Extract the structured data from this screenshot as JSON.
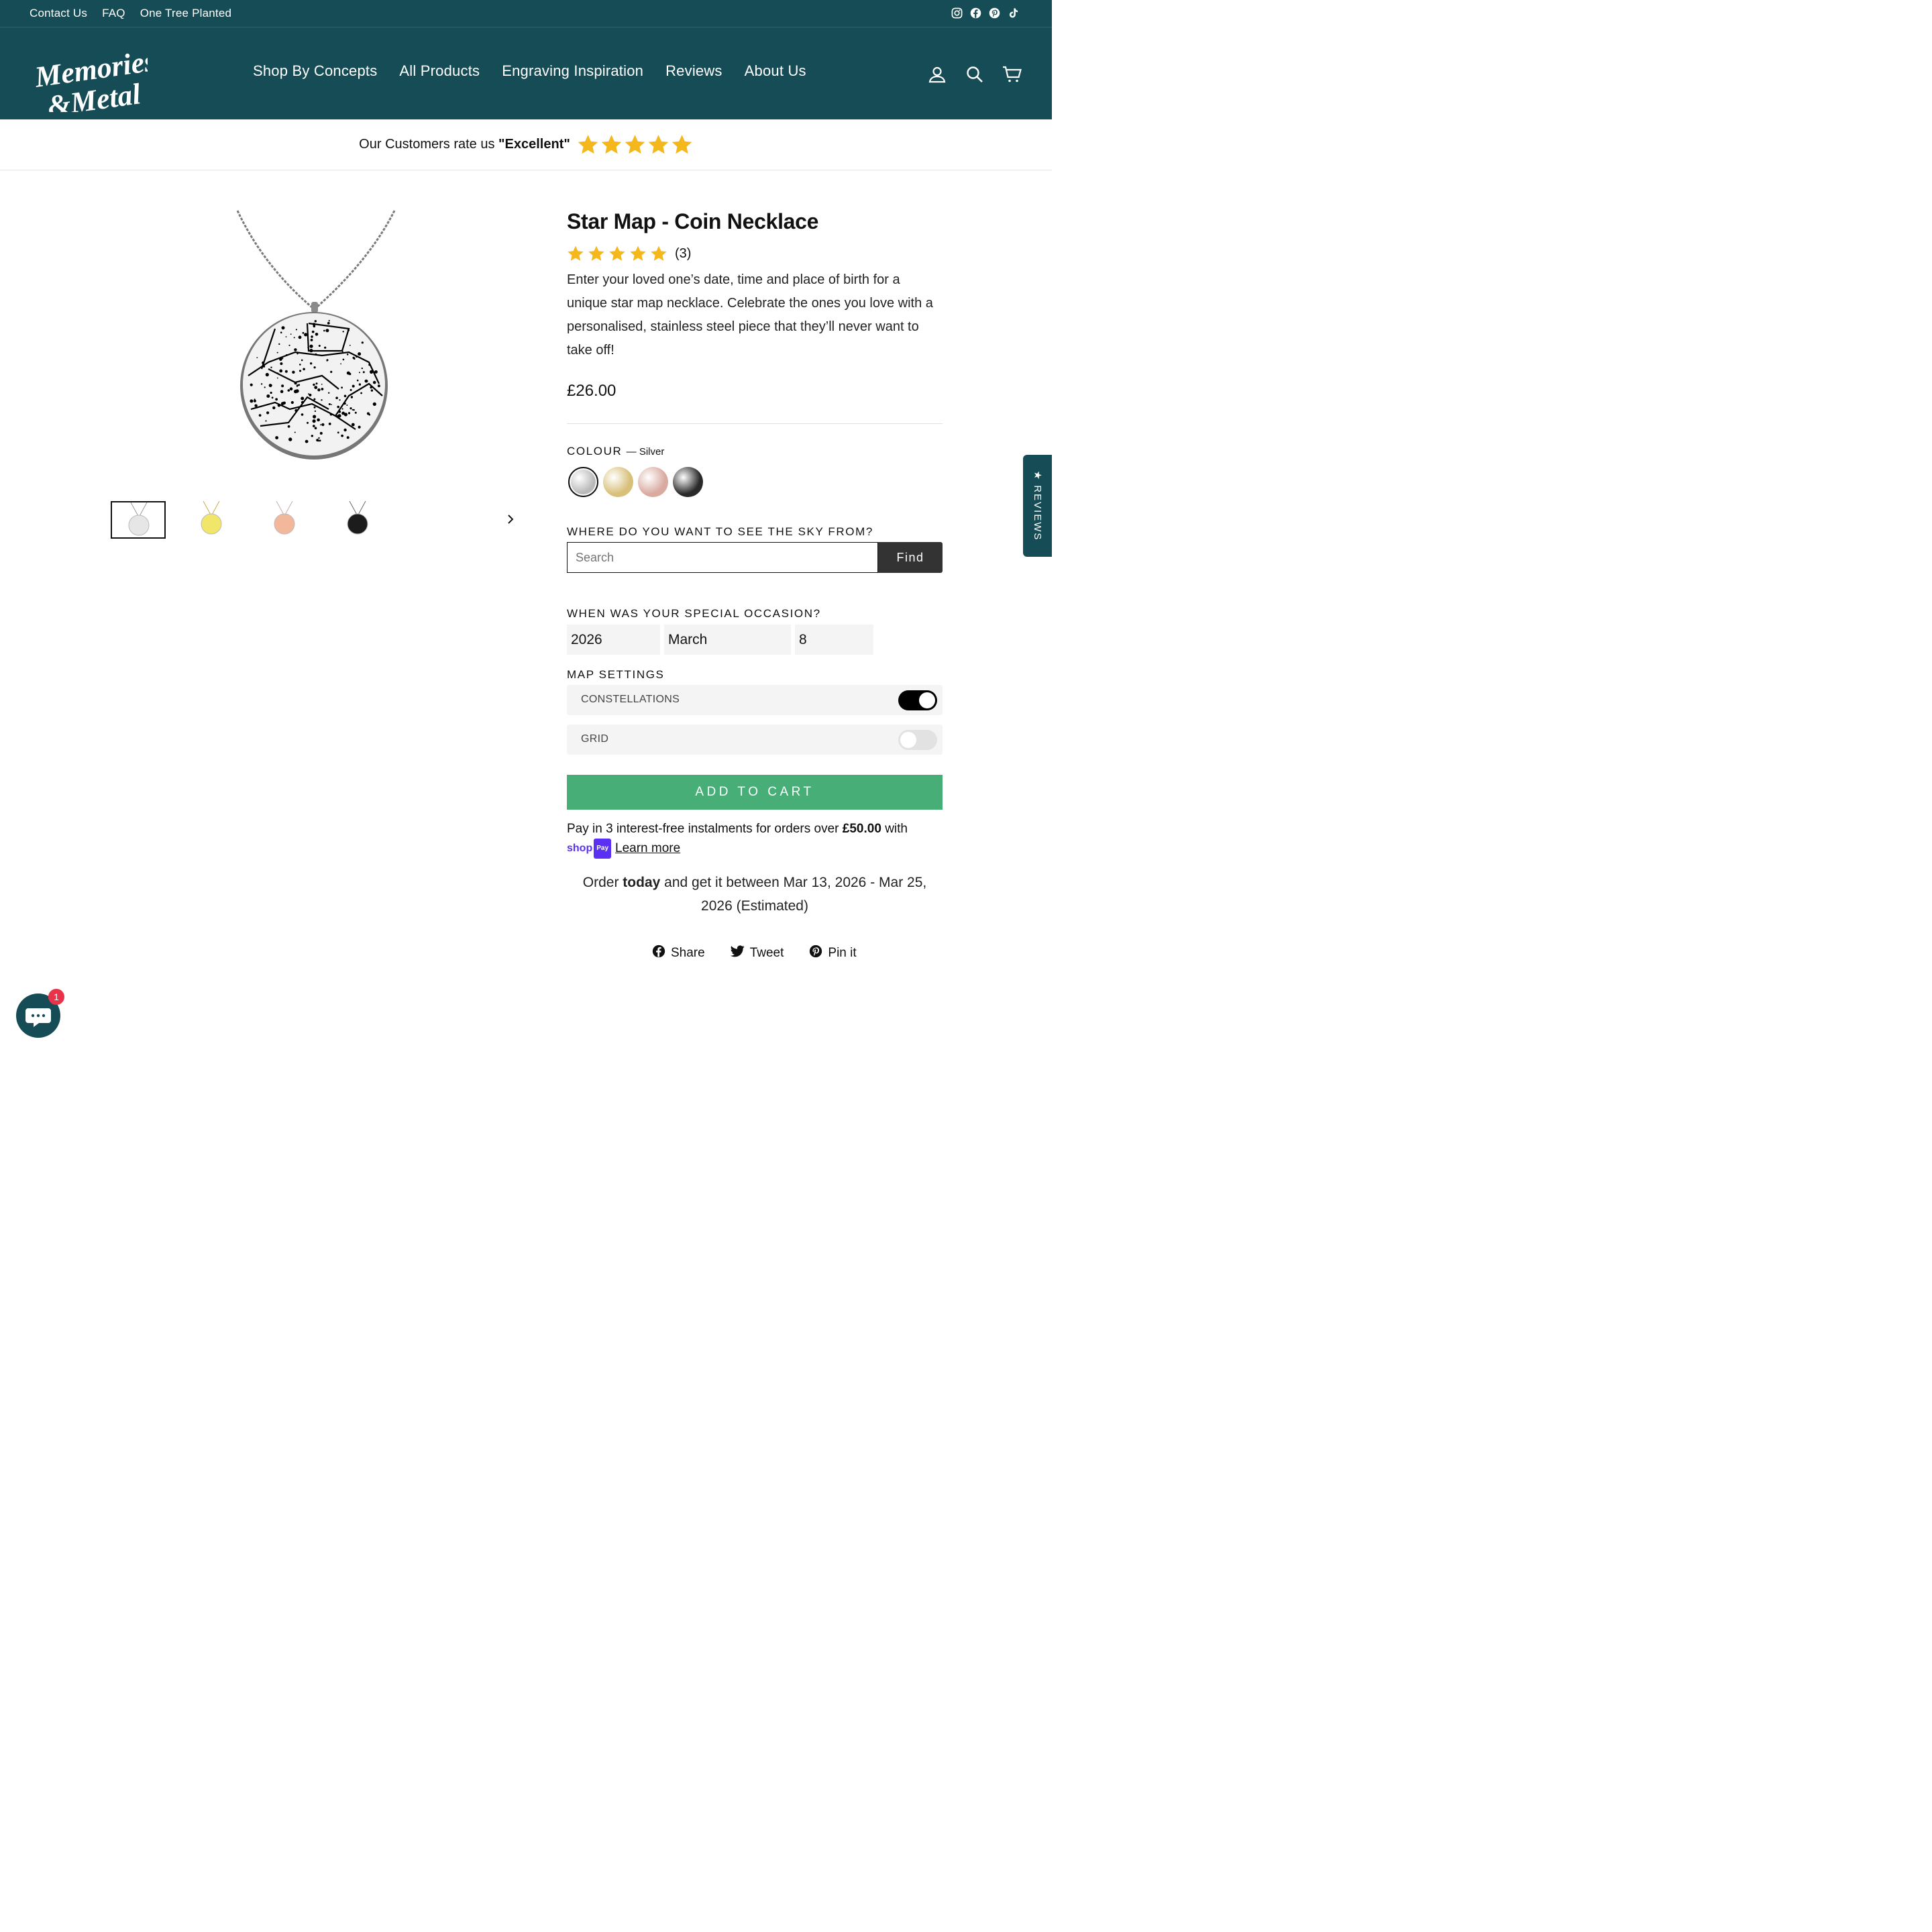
{
  "topbar": {
    "links": [
      "Contact Us",
      "FAQ",
      "One Tree Planted"
    ],
    "social_icons": [
      "instagram-icon",
      "facebook-icon",
      "pinterest-icon",
      "tiktok-icon"
    ]
  },
  "header": {
    "logo_text": "Memories & Metal",
    "nav": [
      "Shop By Concepts",
      "All Products",
      "Engraving Inspiration",
      "Reviews",
      "About Us"
    ],
    "icons": [
      "account-icon",
      "search-icon",
      "cart-icon"
    ]
  },
  "rating_bar": {
    "prefix": "Our Customers rate us ",
    "rating_word": "\"Excellent\"",
    "stars": 5
  },
  "colors": {
    "brand": "#164c55",
    "star": "#f5b81c",
    "add_to_cart": "#48ae78",
    "shop_pay": "#5a31f4"
  },
  "product": {
    "title": "Star Map - Coin Necklace",
    "rating": 5,
    "review_count": "(3)",
    "description": "Enter your loved one’s date, time and place of birth for a unique star map necklace. Celebrate the ones you love with a personalised, stainless steel piece that they’ll never want to take off!",
    "price": "£26.00"
  },
  "thumbnails": [
    {
      "name": "silver",
      "color": "#e6e6e6"
    },
    {
      "name": "gold",
      "color": "#f1e56a"
    },
    {
      "name": "rose-gold",
      "color": "#f3b79c"
    },
    {
      "name": "black",
      "color": "#1c1c1c"
    }
  ],
  "colour": {
    "label": "Colour",
    "selected": "— Silver",
    "swatches": [
      {
        "name": "silver",
        "color": "#b9b9b9"
      },
      {
        "name": "gold",
        "color": "#d8c07a"
      },
      {
        "name": "rose-gold",
        "color": "#d9aaa0"
      },
      {
        "name": "black",
        "color": "#2a2a2a"
      }
    ]
  },
  "location": {
    "label": "Where do you want to see the sky from?",
    "placeholder": "Search",
    "button": "Find"
  },
  "occasion": {
    "label": "When was your special occasion?",
    "year": "2026",
    "month": "March",
    "day": "8"
  },
  "map_settings": {
    "label": "Map settings",
    "options": [
      {
        "label": "CONSTELLATIONS",
        "on": true
      },
      {
        "label": "GRID",
        "on": false
      }
    ]
  },
  "cart": {
    "add_label": "ADD TO CART"
  },
  "shoppay": {
    "text_before": "Pay in 3 interest-free instalments for orders over ",
    "amount": "£50.00",
    "text_after": " with",
    "shop": "shop",
    "pay": "Pay",
    "learn_more": "Learn more"
  },
  "delivery": {
    "prefix": "Order ",
    "today": "today",
    "rest": " and get it between Mar 13, 2026 - Mar 25, 2026 (Estimated)"
  },
  "share": [
    "Share",
    "Tweet",
    "Pin it"
  ],
  "reviews_tab": "★ REVIEWS",
  "chat": {
    "badge": "1"
  }
}
